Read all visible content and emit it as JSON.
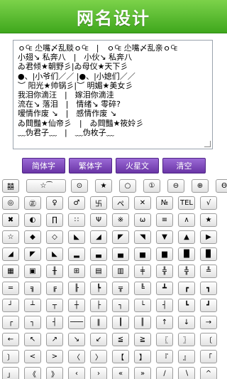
{
  "app": {
    "title": "网名设计"
  },
  "editor": {
    "lines": [
      "ｏ₠ 尐嘴〆乱赕ｏ₠　|　ｏ₠ 尐嘴〆乱亲ｏ₠",
      "小翅↘ 私奔八　|　小伙↘ 私奔八",
      "ゐ君倾★朝野彡|ゐ母仪★天下彡",
      "●、|小爷们／／ |●、|小媳们／／",
      "︶ 阳光★帅锅彡|︶ 明媚★美女彡",
      "我泪你滴汪　|　嫁泪你滴洼",
      "流在↘ 落泪　|　情绪↘ 零碎?",
      "嗳情作废 ↘　|　感情作废 ↘",
      "ゐ閰豔★仙帝彡　|　ゐ閰豔★筱姈彡",
      "﹏伪君子﹏　|　﹏伪枚子﹏"
    ]
  },
  "actions": [
    {
      "id": "simplified",
      "label": "简体字"
    },
    {
      "id": "traditional",
      "label": "繁体字"
    },
    {
      "id": "martian",
      "label": "火星文"
    },
    {
      "id": "clear",
      "label": "清空"
    }
  ],
  "symbol_rows": [
    [
      "囍",
      "☆⁀",
      "⊙",
      "★",
      "○",
      "①",
      "⊖",
      "⊕",
      "Θ"
    ],
    [
      "◎",
      "㊣",
      "♀",
      "♂",
      "卐",
      "ペ",
      "✕",
      "№",
      "TEL",
      "√"
    ],
    [
      "✖",
      "◐",
      "∏",
      "∷",
      "Ψ",
      "※",
      "ω",
      "≡",
      "∧",
      "★"
    ],
    [
      "☆",
      "◆",
      "◇",
      "◣",
      "◢",
      "◤",
      "◥",
      "▼",
      "▲",
      "▶"
    ],
    [
      "◢",
      "◤",
      "◣",
      "▂",
      "▃",
      "▄",
      "▅",
      "▆",
      "█",
      "▉"
    ],
    [
      "▦",
      "▣",
      "╫",
      "⊞",
      "▤",
      "▥",
      "╪",
      "╬",
      "╬",
      "╩"
    ],
    [
      "═",
      "╗",
      "╔",
      "╟",
      "┡",
      "╦",
      "╚",
      "┻",
      "┏",
      "┓"
    ],
    [
      "┘",
      "┴",
      "┬",
      "┼",
      "├",
      "┐",
      "└",
      "┤",
      "┗",
      "┛"
    ],
    [
      "┌",
      "┐",
      "┤",
      "───",
      "‖",
      "┃",
      "║",
      "↑",
      "↓",
      "→"
    ],
    [
      "←",
      "↖",
      "↗",
      "↘",
      "↙",
      "≦",
      "≧",
      "〖",
      "〗",
      "〔"
    ],
    [
      "〕",
      "<",
      ">",
      "〈",
      "〉",
      "【",
      "】",
      "『",
      "』",
      "「"
    ],
    [
      "」",
      "《",
      "》",
      "‹",
      "›",
      "«",
      "»",
      "∕",
      "∖",
      "^"
    ],
    [
      "∩",
      "∪",
      "∈",
      "∋",
      "⊂",
      "⊃",
      "﹌",
      "﹊",
      "﹋",
      "﹉"
    ]
  ]
}
